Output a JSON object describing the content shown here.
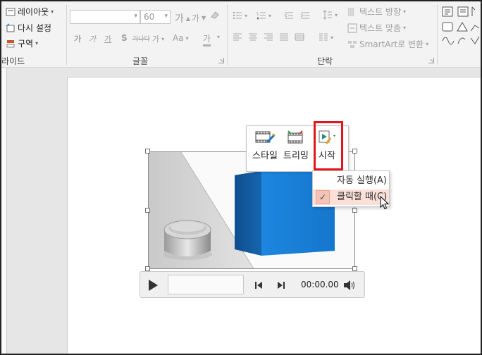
{
  "ribbon": {
    "slides_group": {
      "layout_label": "레이아웃",
      "reset_label": "다시 설정",
      "section_label": "구역",
      "group_label": "라이드"
    },
    "font_group": {
      "font_name_value": "",
      "font_size_value": "60",
      "grow_label": "가",
      "shrink_label": "가",
      "bold_label": "가",
      "italic_label": "가",
      "underline_label": "가",
      "shadow_label": "S",
      "strike_label": "가나다",
      "spacing_label": "가",
      "case_label": "Aa",
      "color_label": "가",
      "group_label": "글꼴"
    },
    "paragraph_group": {
      "text_direction_label": "텍스트 방향",
      "align_text_label": "텍스트 맞춤",
      "smartart_label": "SmartArt로 변환",
      "group_label": "단락"
    }
  },
  "mini_toolbar": {
    "style_label": "스타일",
    "trim_label": "트리밍",
    "start_label": "시작"
  },
  "start_menu": {
    "items": [
      {
        "label": "자동 실행(A)",
        "selected": false
      },
      {
        "label": "클릭할 때(C)",
        "selected": true
      }
    ],
    "check_mark": "✓"
  },
  "media_controls": {
    "time": "00:00.00"
  },
  "colors": {
    "highlight_border": "#e3171b",
    "selected_item_bg": "#fbe0d8",
    "cube_blue": "#1a7fd6"
  }
}
